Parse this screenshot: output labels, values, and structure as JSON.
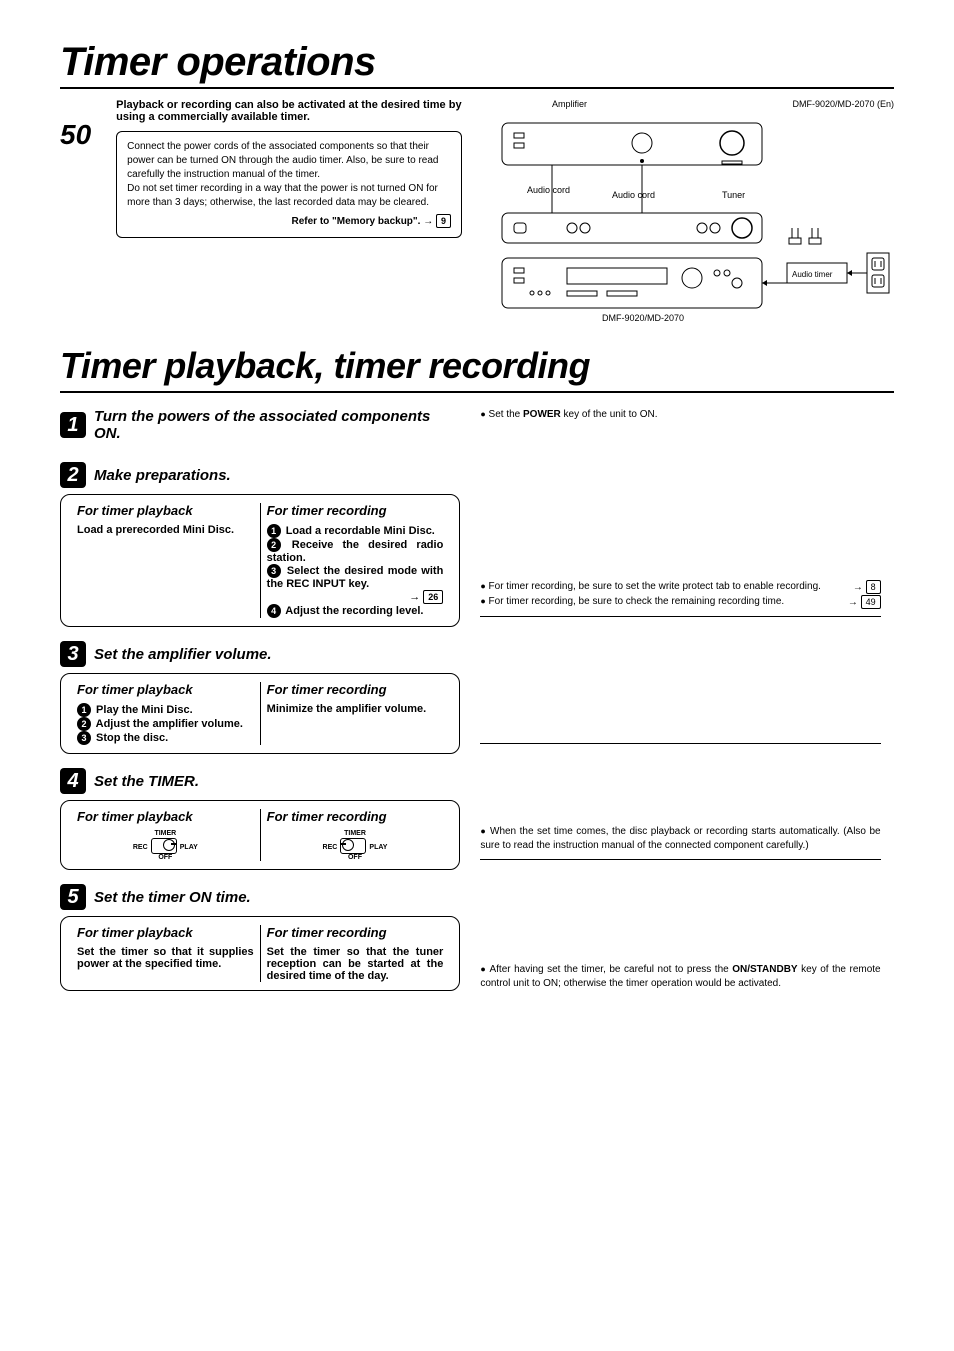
{
  "main_title": "Timer operations",
  "page_number": "50",
  "intro": {
    "lead": "Playback or recording can also be activated at the desired time by using a commercially available timer.",
    "box1": "Connect the power cords of the associated components so that their power can be turned ON through the audio timer. Also, be sure to read carefully the instruction manual of the timer.",
    "box2": "Do not set timer recording in a way that the power is not turned ON for more than 3 days; otherwise, the last recorded data may be cleared.",
    "ref_text": "Refer to \"Memory backup\". →",
    "ref_page": "9"
  },
  "diagram": {
    "amp": "Amplifier",
    "model": "DMF-9020/MD-2070 (En)",
    "audio_cord1": "Audio cord",
    "audio_cord2": "Audio cord",
    "tuner": "Tuner",
    "audio_timer": "Audio timer",
    "bottom": "DMF-9020/MD-2070"
  },
  "sub_title": "Timer playback, timer recording",
  "steps": {
    "s1": {
      "num": "1",
      "heading": "Turn the powers of the associated components ON.",
      "note_prefix": "Set the ",
      "note_bold": "POWER",
      "note_suffix": " key of the unit to ON."
    },
    "s2": {
      "num": "2",
      "heading": "Make preparations.",
      "pb_heading": "For timer playback",
      "rec_heading": "For timer recording",
      "pb_body": "Load a prerecorded Mini Disc.",
      "rec_l1": " Load a recordable Mini Disc.",
      "rec_l2": " Receive the desired radio station.",
      "rec_l3": " Select the desired mode with the REC INPUT key.",
      "rec_l3_ref": "26",
      "rec_l4": " Adjust the recording level.",
      "note1": "For timer recording, be sure to set the write protect tab to enable recording.",
      "note1_ref": "8",
      "note2": "For timer recording, be sure to check the remaining recording time.",
      "note2_ref": "49"
    },
    "s3": {
      "num": "3",
      "heading": "Set the amplifier volume.",
      "pb_heading": "For timer playback",
      "rec_heading": "For timer recording",
      "pb_l1": " Play the Mini Disc.",
      "pb_l2": " Adjust the amplifier volume.",
      "pb_l3": " Stop the disc.",
      "rec_body": "Minimize the amplifier volume."
    },
    "s4": {
      "num": "4",
      "heading": "Set the TIMER.",
      "pb_heading": "For timer playback",
      "rec_heading": "For timer recording",
      "timer_label": "TIMER",
      "rec_label": "REC",
      "play_label": "PLAY",
      "off_label": "OFF",
      "note": "When the set time comes, the disc playback or recording starts automatically. (Also be sure to read the instruction manual of the connected component carefully.)"
    },
    "s5": {
      "num": "5",
      "heading": "Set the timer ON time.",
      "pb_heading": "For timer playback",
      "rec_heading": "For timer recording",
      "pb_body": "Set the timer so that it supplies power at the specified time.",
      "rec_body": "Set the timer so that the tuner reception can be started at the desired time of the day.",
      "note_prefix": "After having set the timer, be careful not to press the ",
      "note_bold": "ON/STANDBY",
      "note_suffix": " key of the remote control unit to ON; otherwise the timer operation would be activated."
    }
  }
}
